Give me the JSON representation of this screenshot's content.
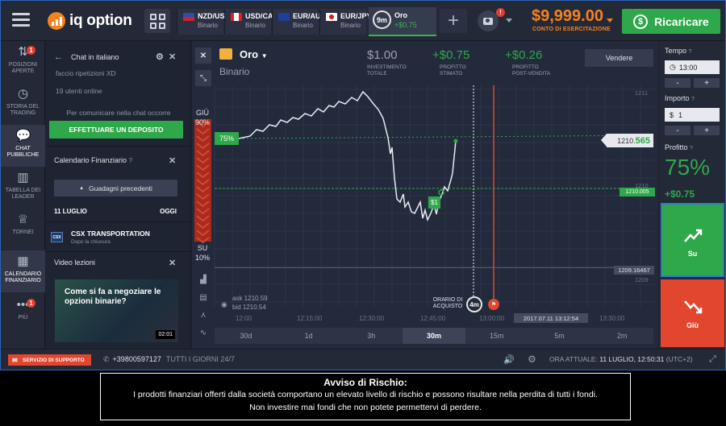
{
  "brand": {
    "name": "iq option"
  },
  "header": {
    "assets": [
      {
        "name": "NZD/USD",
        "type": "Binario"
      },
      {
        "name": "USD/CAD",
        "type": "Binario"
      },
      {
        "name": "EUR/AUD",
        "type": "Binario"
      },
      {
        "name": "EUR/JPY",
        "type": "Binario"
      }
    ],
    "active_asset": {
      "timer": "9m",
      "name": "Oro",
      "profit": "+$0.75"
    },
    "add_label": "+",
    "camera_badge": "!",
    "balance": "$9,999.00",
    "balance_label": "CONTO DI ESERCITAZIONE",
    "recharge_label": "Ricaricare"
  },
  "leftnav": [
    {
      "label": "POSIZIONI APERTE",
      "icon": "open-positions-icon",
      "badge": "1"
    },
    {
      "label": "STORIA DEL TRADING",
      "icon": "history-icon"
    },
    {
      "label": "CHAT PUBBLICHE",
      "icon": "chat-icon"
    },
    {
      "label": "TABELLA DEI LEADER",
      "icon": "leaderboard-icon"
    },
    {
      "label": "TORNEI",
      "icon": "trophy-icon"
    },
    {
      "label": "CALENDARIO FINANZIARIO",
      "icon": "calendar-icon"
    },
    {
      "label": "PIÙ",
      "icon": "more-icon",
      "badge": "1"
    }
  ],
  "chat": {
    "title": "Chat in italiano",
    "room": "faccio ripetizioni XD",
    "users": "19 utenti online",
    "note": "Per comunicare nella chat occorre",
    "deposit_label": "EFFETTUARE UN DEPOSITO"
  },
  "calendar": {
    "title": "Calendario Finanziario",
    "prev_label": "Guadagni precedenti",
    "date": "11 LUGLIO",
    "today": "OGGI",
    "event_code": "CSX",
    "event_name": "CSX TRANSPORTATION",
    "event_note": "Dopo la chiusura"
  },
  "video": {
    "title": "Video lezioni",
    "caption": "Come si fa a negoziare le opzioni binarie?",
    "duration": "02:01"
  },
  "chart": {
    "asset": "Oro",
    "mode": "Binario",
    "investment": "$1.00",
    "investment_label": "INVESTIMENTO TOTALE",
    "profit_est": "+$0.75",
    "profit_est_label": "PROFITTO STIMATO",
    "profit_post": "+$0.26",
    "profit_post_label": "PROFITTO POST-VENDITA",
    "sell_label": "Vendere",
    "down_label": "GIÙ",
    "down_pct": "90%",
    "up_label": "SU",
    "up_pct": "10%",
    "pct_tag": "75%",
    "dollar_tag": "$1",
    "ask": "ask 1210.59",
    "bid": "bid 1210.54",
    "purchase_time_label": "ORARIO DI ACQUISTO",
    "timer": "4m",
    "date_tag": "2017.07.11 13:12:54",
    "price_prefix": "1210.",
    "price_suffix": "565",
    "strike": "1210.005",
    "level": "1209.16467",
    "y_ticks": [
      "1211",
      "1210",
      "1209"
    ],
    "x_ticks": [
      "12:00",
      "12:15:00",
      "12:30:00",
      "12:45:00",
      "13:00:00",
      "13:15:00",
      "13:30:00"
    ],
    "timeframes": [
      "30d",
      "1d",
      "3h",
      "30m",
      "15m",
      "5m",
      "2m"
    ],
    "active_timeframe": "30m"
  },
  "chart_data": {
    "type": "line",
    "x": [
      "12:00",
      "12:15:00",
      "12:30:00",
      "12:45:00",
      "13:00:00"
    ],
    "values": [
      1210.4,
      1210.9,
      1211.1,
      1209.5,
      1210.565
    ],
    "ylim": [
      1209,
      1211.5
    ]
  },
  "trade": {
    "time_label": "Tempo",
    "time_value": "13:00",
    "amount_label": "Importo",
    "amount_value": "1",
    "currency": "$",
    "profit_label": "Profitto",
    "profit_pct": "75%",
    "profit_amount": "+$0.75",
    "up_label": "Su",
    "down_label": "Giù",
    "minus": "-",
    "plus": "+"
  },
  "footer": {
    "support_label": "SERVIZIO DI SUPPORTO",
    "phone": "+39800597127",
    "hours": "TUTTI I GIORNI 24/7",
    "time_label": "ORA ATTUALE:",
    "time_value": "11 LUGLIO, 12:50:31",
    "tz": "(UTC+2)"
  },
  "risk": {
    "title": "Avviso di Rischio:",
    "line1": "I prodotti finanziari offerti dalla società comportano un elevato livello di rischio e possono risultare nella perdita di tutti i fondi.",
    "line2": "Non investire mai fondi che non potete permettervi di perdere."
  },
  "colors": {
    "accent": "#f5821f",
    "green": "#2ea84a",
    "red": "#e2462e",
    "panel": "#242938"
  }
}
